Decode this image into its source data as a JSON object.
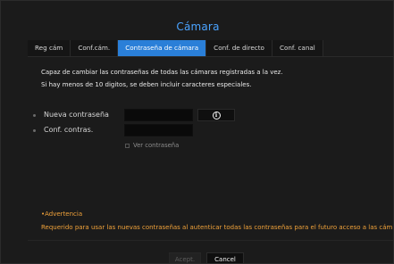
{
  "dialog": {
    "title": "Cámara"
  },
  "tabs": [
    {
      "label": "Reg cám",
      "active": false
    },
    {
      "label": "Conf.cám.",
      "active": false
    },
    {
      "label": "Contraseña de cámara",
      "active": true
    },
    {
      "label": "Conf. de directo",
      "active": false
    },
    {
      "label": "Conf. canal",
      "active": false
    }
  ],
  "description": {
    "line1": "Capaz de cambiar las contraseñas de todas las cámaras registradas a la vez.",
    "line2": "Si hay menos de 10 digitos, se deben incluir caracteres especiales."
  },
  "form": {
    "new_password_label": "Nueva contraseña",
    "new_password_value": "",
    "confirm_label": "Conf. contras.",
    "confirm_value": "",
    "show_password_label": "Ver contraseña",
    "show_password_checked": false,
    "info_icon": "info-icon"
  },
  "warning": {
    "title": "•Advertencia",
    "text": "Requerido para usar las nuevas contraseñas al autenticar todas las contraseñas para el futuro acceso a las cám"
  },
  "buttons": {
    "accept_label": "Acept.",
    "cancel_label": "Cancel"
  },
  "colors": {
    "accent": "#2a7fd8",
    "title": "#4aa3ff",
    "warning": "#f0a23a",
    "background": "#1b1b1b"
  }
}
